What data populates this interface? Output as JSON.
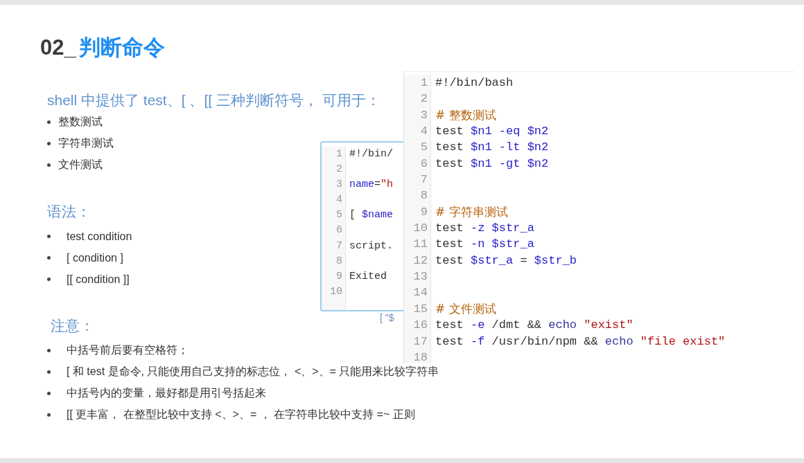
{
  "slide": {
    "number": "02_",
    "title": "判断命令",
    "intro": "shell 中提供了 test、[ 、[[ 三种判断符号， 可用于：",
    "uses": [
      "整数测试",
      "字符串测试",
      "文件测试"
    ],
    "syntax_heading": "语法：",
    "syntax": [
      "test condition",
      "[ condition ]",
      "[[ condition ]]"
    ],
    "notes_heading": "注意：",
    "notes": [
      "中括号前后要有空格符；",
      "[ 和 test 是命令, 只能使用自己支持的标志位， <、>、= 只能用来比较字符串",
      "中括号内的变量，最好都是用引号括起来",
      "[[ 更丰富， 在整型比较中支持 <、>、= ， 在字符串比较中支持 =~ 正则"
    ],
    "back_code": {
      "lines": [
        {
          "n": "1",
          "tokens": [
            {
              "kind": "plain",
              "t": "#!/bin/"
            }
          ]
        },
        {
          "n": "2"
        },
        {
          "n": "3",
          "tokens": [
            {
              "kind": "var",
              "t": "name"
            },
            {
              "kind": "plain",
              "t": "="
            },
            {
              "kind": "str",
              "t": "\"h"
            }
          ]
        },
        {
          "n": "4"
        },
        {
          "n": "5",
          "tokens": [
            {
              "kind": "plain",
              "t": "[ "
            },
            {
              "kind": "var",
              "t": "$name"
            }
          ]
        },
        {
          "n": "6"
        },
        {
          "n": "7",
          "tokens": [
            {
              "kind": "plain",
              "t": "script."
            }
          ]
        },
        {
          "n": "8"
        },
        {
          "n": "9",
          "tokens": [
            {
              "kind": "plain",
              "t": "Exited"
            }
          ]
        },
        {
          "n": "10"
        }
      ]
    },
    "back_fragment": "[ \"$",
    "front_code": {
      "lines": [
        {
          "n": "1",
          "tokens": [
            {
              "kind": "plain",
              "t": "#!/bin/bash"
            }
          ]
        },
        {
          "n": "2"
        },
        {
          "n": "3",
          "tokens": [
            {
              "kind": "comment",
              "t": "# 整数测试"
            }
          ]
        },
        {
          "n": "4",
          "tokens": [
            {
              "kind": "plain",
              "t": "test "
            },
            {
              "kind": "var",
              "t": "$n1 -eq $n2"
            }
          ]
        },
        {
          "n": "5",
          "tokens": [
            {
              "kind": "plain",
              "t": "test "
            },
            {
              "kind": "var",
              "t": "$n1 -lt $n2"
            }
          ]
        },
        {
          "n": "6",
          "tokens": [
            {
              "kind": "plain",
              "t": "test "
            },
            {
              "kind": "var",
              "t": "$n1 -gt $n2"
            }
          ]
        },
        {
          "n": "7"
        },
        {
          "n": "8"
        },
        {
          "n": "9",
          "tokens": [
            {
              "kind": "comment",
              "t": "# 字符串测试"
            }
          ]
        },
        {
          "n": "10",
          "tokens": [
            {
              "kind": "plain",
              "t": "test "
            },
            {
              "kind": "var",
              "t": "-z $str_a"
            }
          ]
        },
        {
          "n": "11",
          "tokens": [
            {
              "kind": "plain",
              "t": "test "
            },
            {
              "kind": "var",
              "t": "-n $str_a"
            }
          ]
        },
        {
          "n": "12",
          "tokens": [
            {
              "kind": "plain",
              "t": "test "
            },
            {
              "kind": "var",
              "t": "$str_a"
            },
            {
              "kind": "plain",
              "t": " = "
            },
            {
              "kind": "var",
              "t": "$str_b"
            }
          ]
        },
        {
          "n": "13"
        },
        {
          "n": "14"
        },
        {
          "n": "15",
          "tokens": [
            {
              "kind": "comment",
              "t": "# 文件测试"
            }
          ]
        },
        {
          "n": "16",
          "tokens": [
            {
              "kind": "plain",
              "t": "test "
            },
            {
              "kind": "var",
              "t": "-e"
            },
            {
              "kind": "plain",
              "t": " /dmt && "
            },
            {
              "kind": "kw",
              "t": "echo"
            },
            {
              "kind": "str",
              "t": " \"exist\""
            }
          ]
        },
        {
          "n": "17",
          "tokens": [
            {
              "kind": "plain",
              "t": "test "
            },
            {
              "kind": "var",
              "t": "-f"
            },
            {
              "kind": "plain",
              "t": " /usr/bin/npm && "
            },
            {
              "kind": "kw",
              "t": "echo"
            },
            {
              "kind": "str",
              "t": " \"file exist\""
            }
          ]
        },
        {
          "n": "18"
        }
      ]
    }
  }
}
